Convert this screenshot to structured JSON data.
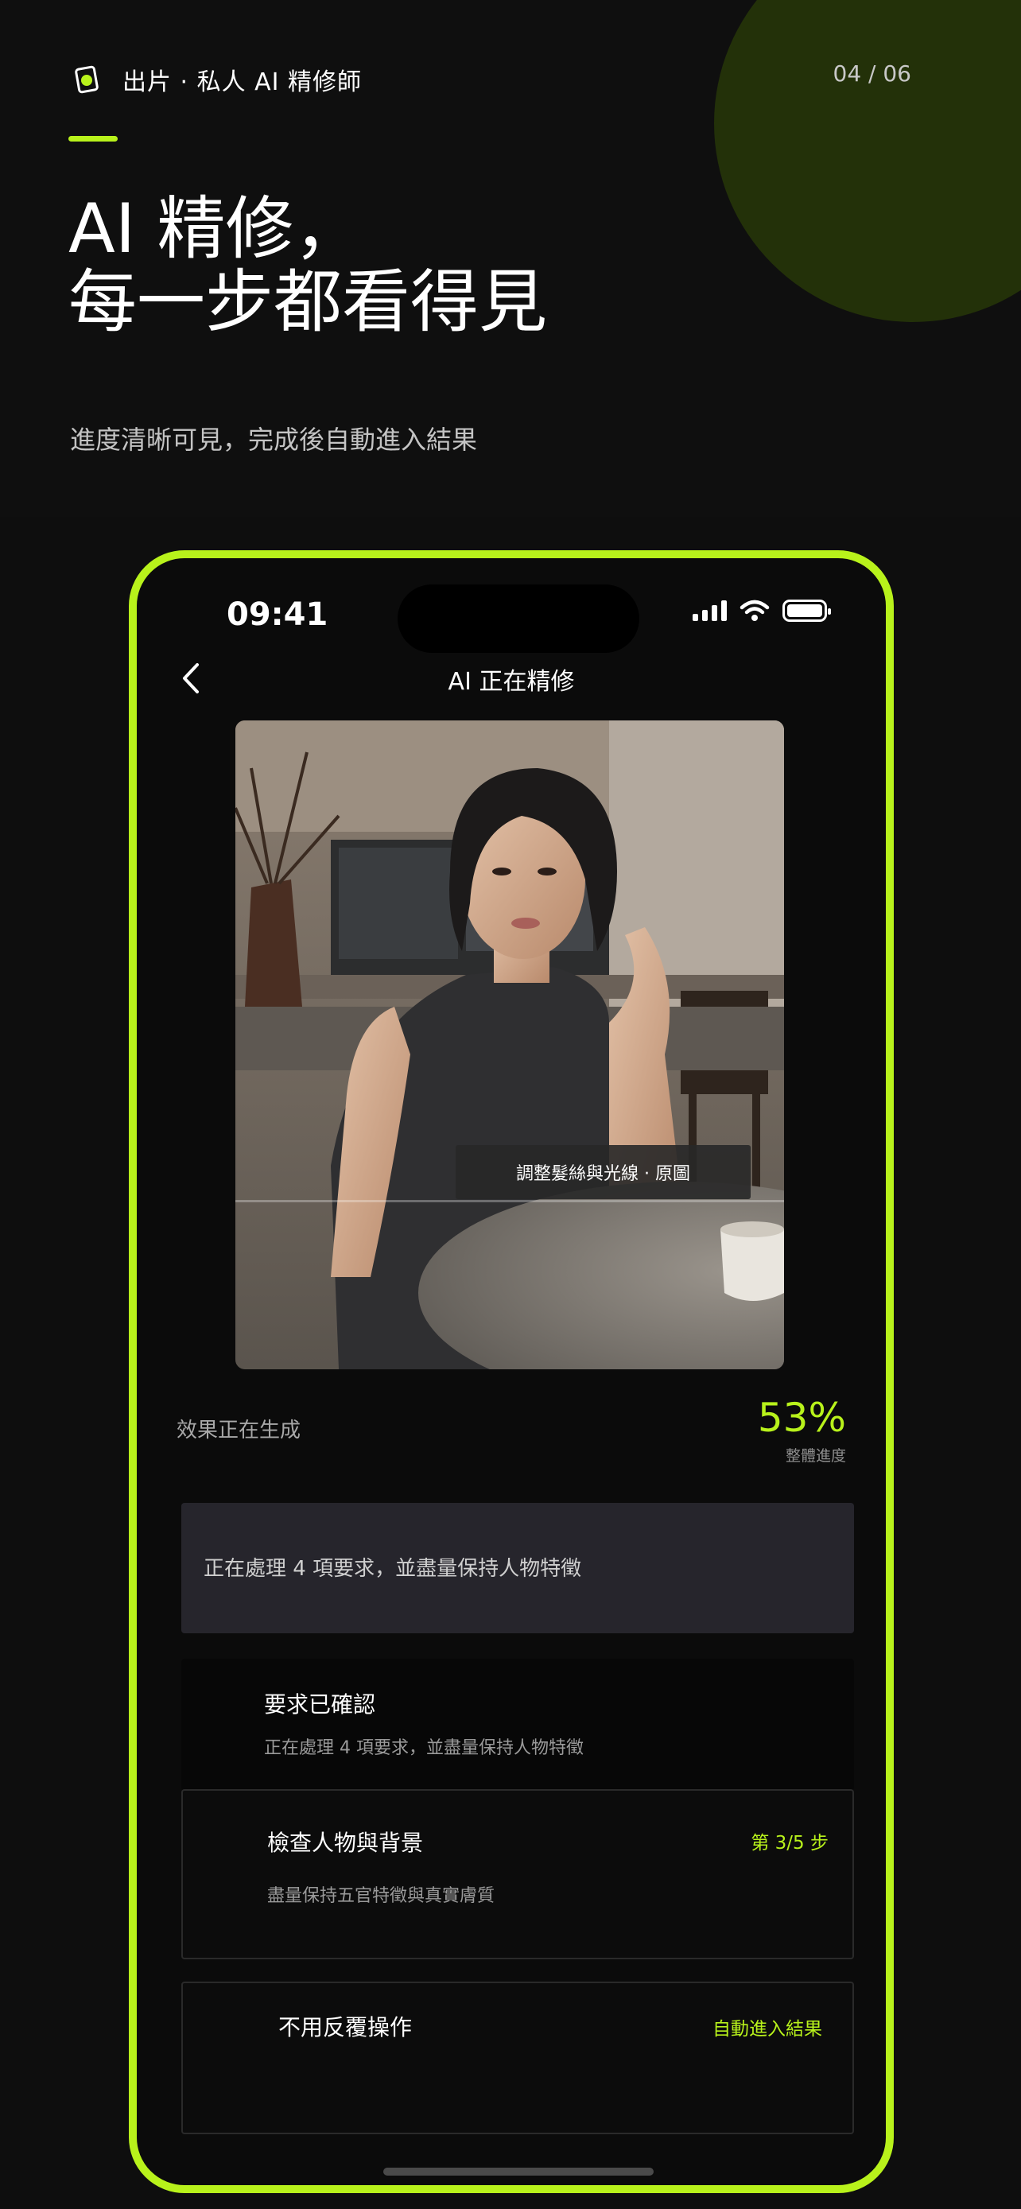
{
  "colors": {
    "accent": "#b8f21b",
    "background": "#0f0f0f"
  },
  "header": {
    "brand_logo_icon": "photo-card-icon",
    "brand_text": "出片 ·  私人 AI 精修師",
    "page_counter": "04 / 06"
  },
  "hero": {
    "title_line1": "AI 精修，",
    "title_line2": "每一步都看得見",
    "subtitle": "進度清晰可見，完成後自動進入結果"
  },
  "phone": {
    "status": {
      "time": "09:41",
      "icons": [
        "signal-icon",
        "wifi-icon",
        "battery-icon"
      ]
    },
    "nav": {
      "back_icon": "chevron-left-icon",
      "title": "AI 正在精修"
    },
    "photo": {
      "caption": "調整髮絲與光線 ·  原圖"
    },
    "progress": {
      "label": "效果正在生成",
      "percent": "53%",
      "percent_value": 53,
      "sub": "整體進度"
    },
    "processing": {
      "text": "正在處理 4 項要求，並盡量保持人物特徵"
    },
    "steps": [
      {
        "title": "要求已確認",
        "desc": "正在處理 4 項要求，並盡量保持人物特徵"
      },
      {
        "title": "檢查人物與背景",
        "desc": "盡量保持五官特徵與真實膚質",
        "badge": "第 3/5 步"
      },
      {
        "title": "不用反覆操作",
        "badge": "自動進入結果"
      }
    ]
  }
}
